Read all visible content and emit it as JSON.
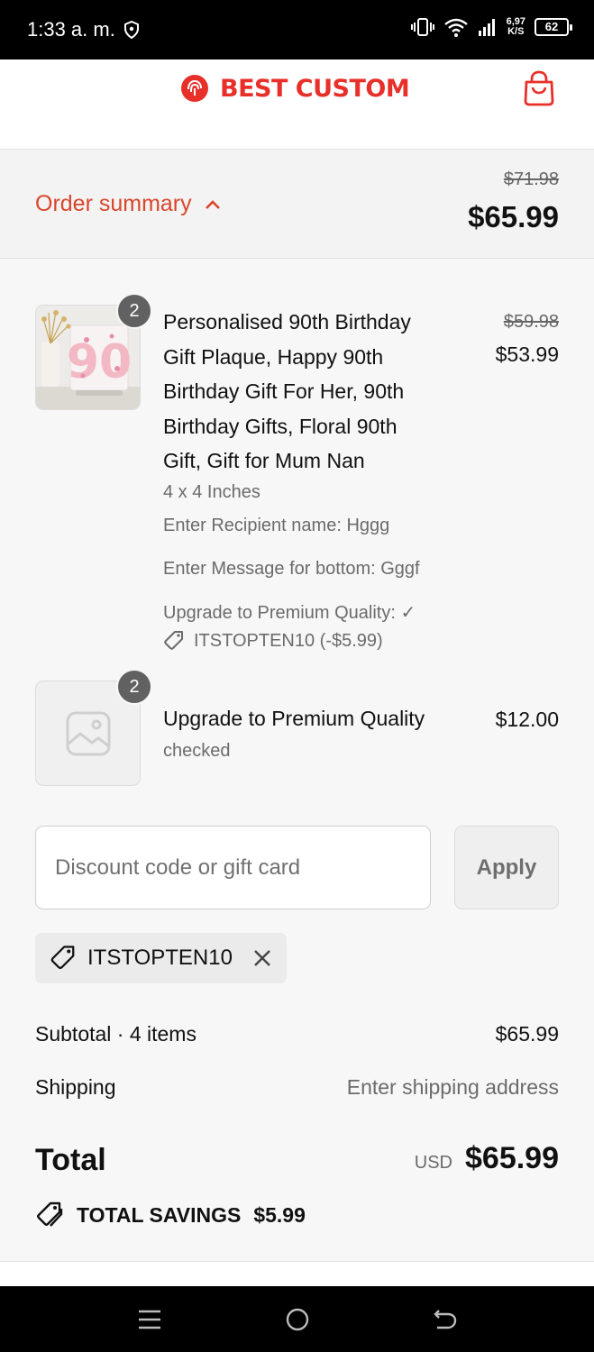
{
  "status_bar": {
    "time": "1:33 a. m.",
    "speed_value": "6,97",
    "speed_unit": "K/S",
    "battery": "62"
  },
  "header": {
    "brand": "BEST CUSTOM",
    "brand_color": "#e8302a",
    "cart_icon": "shopping-bag-icon"
  },
  "summary": {
    "label": "Order summary",
    "original_total": "$71.98",
    "total": "$65.99",
    "accent_color": "#d8462b"
  },
  "items": [
    {
      "quantity": "2",
      "title_lines": [
        "Personalised 90th Birthday",
        "Gift Plaque, Happy 90th",
        "Birthday Gift For Her, 90th",
        "Birthday Gifts, Floral 90th",
        "Gift, Gift for Mum Nan"
      ],
      "original_price": "$59.98",
      "price": "$53.99",
      "variant": "4 x 4 Inches",
      "recipient": "Enter Recipient name: Hggg",
      "message": "Enter Message for bottom: Gggf",
      "upgrade": "Upgrade to Premium Quality: ✓",
      "discount": "ITSTOPTEN10 (-$5.99)"
    },
    {
      "quantity": "2",
      "title": "Upgrade to Premium Quality",
      "price": "$12.00",
      "subtitle": "checked",
      "image_icon": "image-placeholder-icon"
    }
  ],
  "discount": {
    "placeholder": "Discount code or gift card",
    "apply_label": "Apply",
    "applied_code": "ITSTOPTEN10"
  },
  "totals": {
    "subtotal_label": "Subtotal · 4 items",
    "subtotal_value": "$65.99",
    "shipping_label": "Shipping",
    "shipping_value": "Enter shipping address",
    "total_label": "Total",
    "currency": "USD",
    "total_value": "$65.99",
    "savings_label": "TOTAL SAVINGS",
    "savings_value": "$5.99"
  }
}
